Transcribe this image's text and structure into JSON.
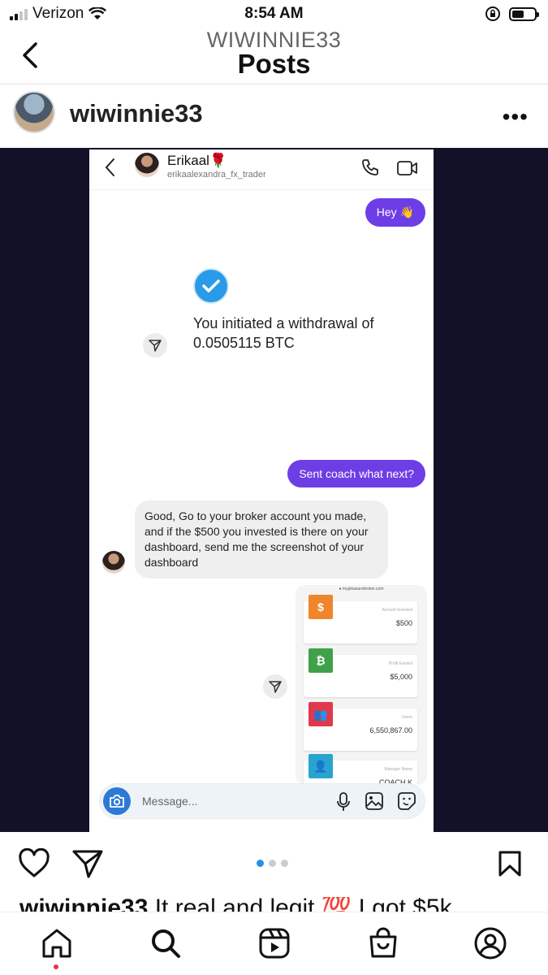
{
  "status_bar": {
    "carrier": "Verizon",
    "time": "8:54 AM"
  },
  "header": {
    "username": "WIWINNIE33",
    "title": "Posts"
  },
  "post": {
    "username": "wiwinnie33",
    "more_label": "•••",
    "caption_user": "wiwinnie33",
    "caption_text": " It real and legit 💯 I got $5k",
    "carousel": {
      "count": 3,
      "active": 1
    }
  },
  "dm": {
    "contact_name": "Erikaal🌹",
    "contact_handle": "erikaalexandra_fx_trader",
    "messages": {
      "hey": "Hey 👋",
      "withdrawal": "You initiated a withdrawal of 0.0505115 BTC",
      "sent_coach": "Sent coach what next?",
      "reply": "Good, Go to your broker account you made, and if the $500 you invested is there on your dashboard, send me the screenshot of your dashboard"
    },
    "dashboard": {
      "url": "● mypleasurebroker.com",
      "cards": [
        {
          "icon": "$",
          "label": "Amount Invested",
          "value": "$500",
          "color": "#f0852a"
        },
        {
          "icon": "₿",
          "label": "Profit Earned",
          "value": "$5,000",
          "color": "#3fa14a"
        },
        {
          "icon": "👥",
          "label": "Users",
          "value": "6,550,867.00",
          "color": "#e0394d"
        },
        {
          "icon": "👤",
          "label": "Manager Name",
          "value": "COACH K",
          "color": "#28a4cf"
        }
      ]
    },
    "message_placeholder": "Message..."
  },
  "colors": {
    "bubble_out": "#6d3ee6",
    "accent_blue": "#2a8ee8",
    "image_bg": "#121128"
  },
  "icons": {
    "header": [
      "back-chevron-icon"
    ],
    "actions": [
      "heart-icon",
      "send-icon",
      "bookmark-icon"
    ],
    "tabs": [
      "home-icon",
      "search-icon",
      "reels-icon",
      "shop-icon",
      "profile-icon"
    ]
  }
}
